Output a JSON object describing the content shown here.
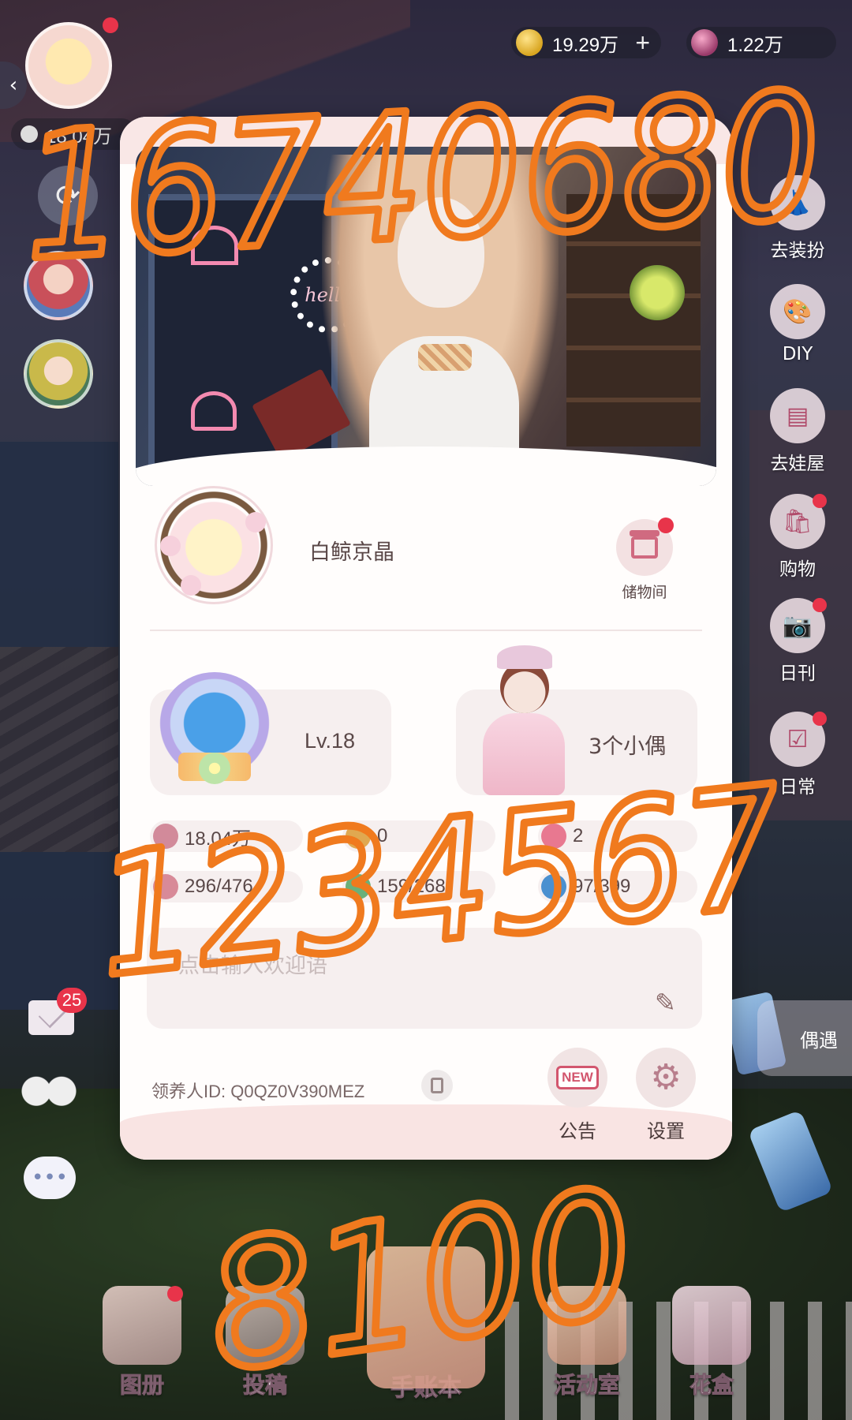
{
  "currency": {
    "gold": {
      "icon": "gold-coin-icon",
      "amount": "19.29万",
      "plus": "+"
    },
    "gem": {
      "icon": "gem-icon",
      "amount": "1.22万"
    }
  },
  "left_hud": {
    "visitors": "18.04万",
    "mail_badge": "25"
  },
  "right_hud": {
    "buttons": [
      {
        "label": "去装扮",
        "icon": "dressup-icon",
        "dot": false
      },
      {
        "label": "DIY",
        "icon": "palette-icon",
        "dot": false
      },
      {
        "label": "去娃屋",
        "icon": "cabinet-icon",
        "dot": false
      },
      {
        "label": "购物",
        "icon": "shopping-bag-icon",
        "dot": true
      },
      {
        "label": "日刊",
        "icon": "camera-icon",
        "dot": true
      },
      {
        "label": "日常",
        "icon": "checklist-icon",
        "dot": true
      }
    ],
    "encounter_label": "偶遇"
  },
  "profile": {
    "name": "白鲸京晶",
    "storage_label": "储物间",
    "level": "Lv.18",
    "doll_count": "3个小偶",
    "stats": [
      {
        "icon": "person-icon",
        "value": "18.04万"
      },
      {
        "icon": "footprint-icon",
        "value": "0"
      },
      {
        "icon": "heart-icon",
        "value": "2"
      },
      {
        "icon": "dress-icon",
        "value": "296/476"
      },
      {
        "icon": "book-icon",
        "value": "159/268"
      },
      {
        "icon": "hat-icon",
        "value": "97/399"
      }
    ],
    "greeting_placeholder": "点击输入欢迎语",
    "adopter_id": "领养人ID:  Q0QZ0V390MEZ",
    "notice_tag": "NEW",
    "notice_label": "公告",
    "settings_label": "设置"
  },
  "dock": {
    "items": [
      {
        "label": "图册",
        "dot": true
      },
      {
        "label": "投稿",
        "dot": false
      },
      {
        "label": "手账本",
        "dot": false
      },
      {
        "label": "活动室",
        "dot": false
      },
      {
        "label": "花盒",
        "dot": false
      }
    ]
  },
  "handwriting": {
    "top": "16740680",
    "middle": "1234567",
    "bottom": "8100",
    "color": "#f07a1e"
  }
}
